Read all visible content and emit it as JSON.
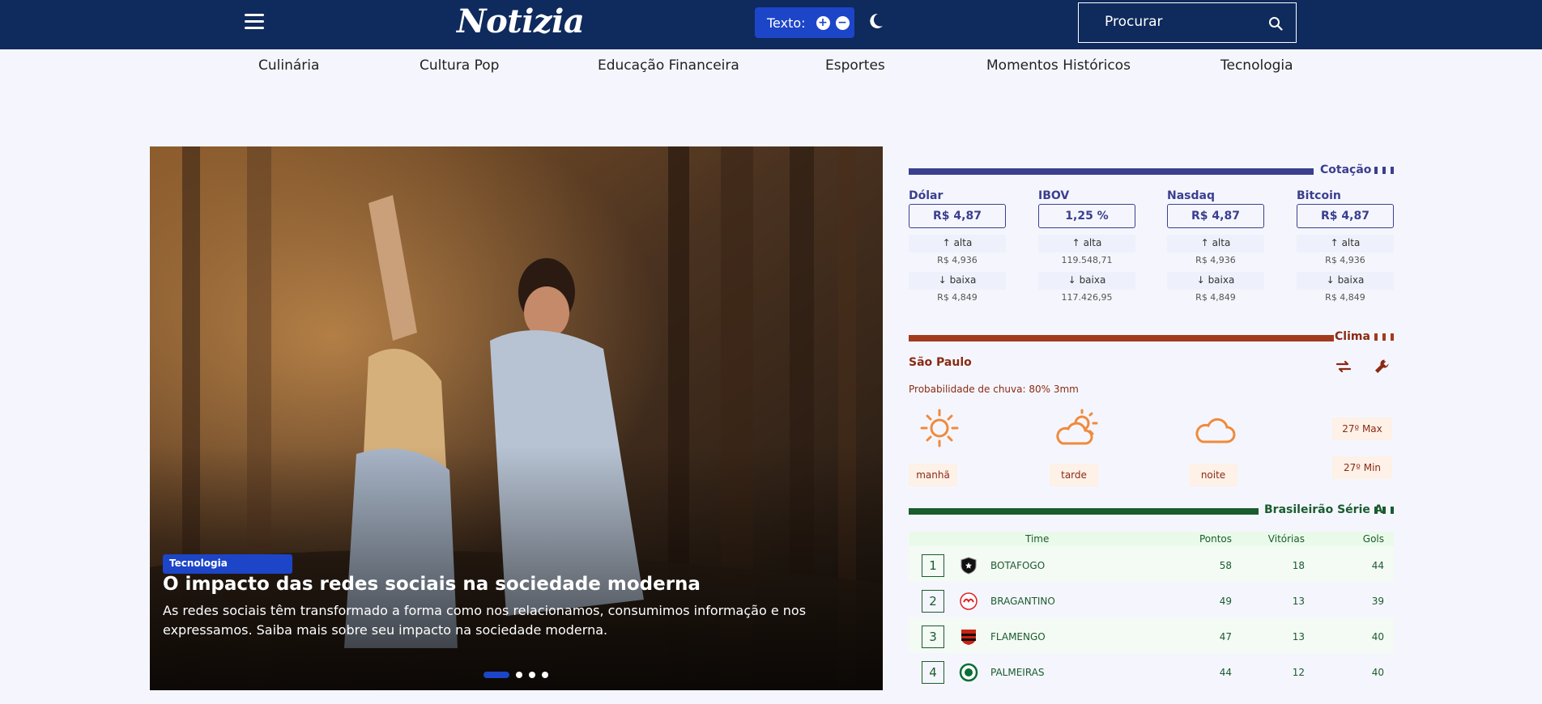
{
  "header": {
    "logo": "Notizia",
    "text_size_label": "Texto:",
    "increase_symbol": "+",
    "decrease_symbol": "−",
    "search_placeholder": "Procurar"
  },
  "categories": [
    "Culinária",
    "Cultura Pop",
    "Educação Financeira",
    "Esportes",
    "Momentos Históricos",
    "Tecnologia"
  ],
  "hero": {
    "tag": "Tecnologia",
    "title": "O impacto das redes sociais na sociedade moderna",
    "description": "As redes sociais têm transformado a forma como nos relacionamos, consumimos informação e nos expressamos. Saiba mais sobre seu impacto na sociedade moderna.",
    "slides": 4,
    "active_slide": 1
  },
  "quotes": {
    "title": "Cotação",
    "items": [
      {
        "name": "Dólar",
        "value": "R$ 4,87",
        "up_label": "alta",
        "up_value": "R$ 4,936",
        "down_label": "baixa",
        "down_value": "R$ 4,849"
      },
      {
        "name": "IBOV",
        "value": "1,25 %",
        "up_label": "alta",
        "up_value": "119.548,71",
        "down_label": "baixa",
        "down_value": "117.426,95"
      },
      {
        "name": "Nasdaq",
        "value": "R$ 4,87",
        "up_label": "alta",
        "up_value": "R$ 4,936",
        "down_label": "baixa",
        "down_value": "R$ 4,849"
      },
      {
        "name": "Bitcoin",
        "value": "R$ 4,87",
        "up_label": "alta",
        "up_value": "R$ 4,936",
        "down_label": "baixa",
        "down_value": "R$ 4,849"
      }
    ]
  },
  "weather": {
    "title": "Clima",
    "city": "São Paulo",
    "rain": "Probabilidade de chuva: 80% 3mm",
    "periods": [
      {
        "label": "manhã",
        "icon": "sun-icon"
      },
      {
        "label": "tarde",
        "icon": "partly-cloudy-icon"
      },
      {
        "label": "noite",
        "icon": "cloud-icon"
      }
    ],
    "max": "27º Max",
    "min": "27º Min"
  },
  "league": {
    "title": "Brasileirão Série A",
    "headers": {
      "team": "Time",
      "points": "Pontos",
      "wins": "Vitórias",
      "goals": "Gols"
    },
    "rows": [
      {
        "pos": "1",
        "team": "BOTAFOGO",
        "points": "58",
        "wins": "18",
        "goals": "44"
      },
      {
        "pos": "2",
        "team": "BRAGANTINO",
        "points": "49",
        "wins": "13",
        "goals": "39"
      },
      {
        "pos": "3",
        "team": "FLAMENGO",
        "points": "47",
        "wins": "13",
        "goals": "40"
      },
      {
        "pos": "4",
        "team": "PALMEIRAS",
        "points": "44",
        "wins": "12",
        "goals": "40"
      }
    ]
  },
  "colors": {
    "header_bg": "#0f2a5c",
    "accent": "#1d45c8",
    "quotes": "#3b3f8f",
    "weather": "#a33a1e",
    "league": "#1a5c2e",
    "weather_icon": "#f08a3c"
  }
}
